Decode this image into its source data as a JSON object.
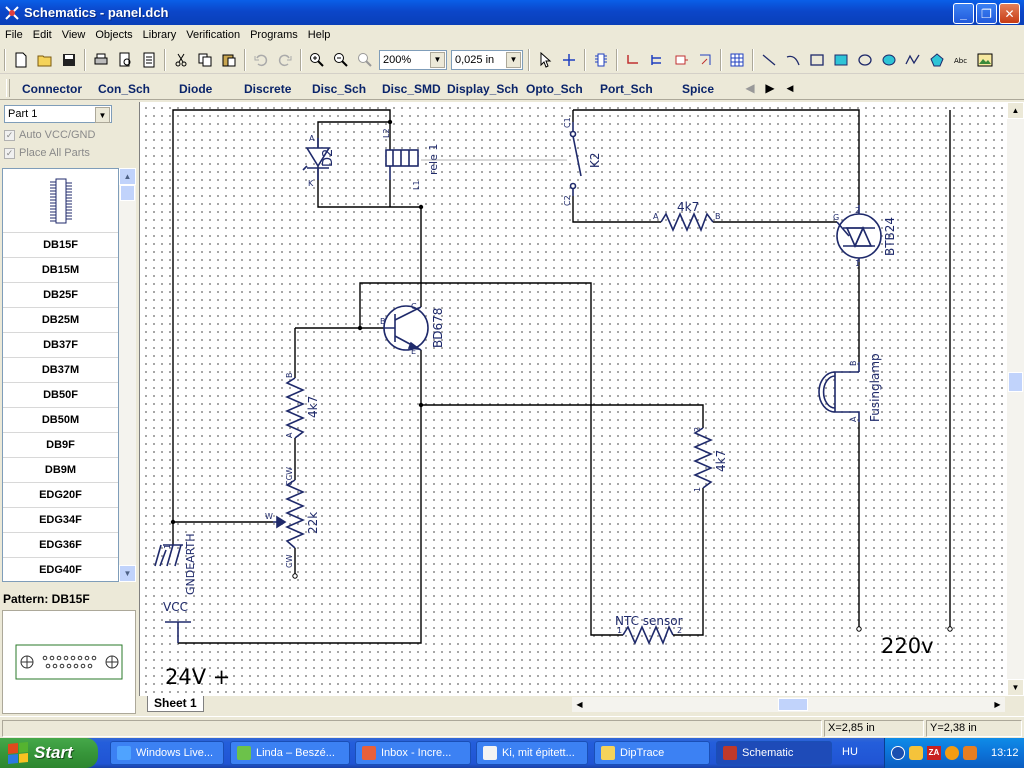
{
  "window": {
    "title": "Schematics - panel.dch",
    "buttons": {
      "minimize": "_",
      "maximize": "❐",
      "close": "✕"
    }
  },
  "menu": [
    "File",
    "Edit",
    "View",
    "Objects",
    "Library",
    "Verification",
    "Programs",
    "Help"
  ],
  "toolbar": {
    "zoom": "200%",
    "grid": "0,025 in"
  },
  "libraries": [
    "Connector",
    "Con_Sch",
    "Diode",
    "Discrete",
    "Disc_Sch",
    "Disc_SMD",
    "Display_Sch",
    "Opto_Sch",
    "Port_Sch",
    "Spice"
  ],
  "left_panel": {
    "part": "Part 1",
    "auto_vcc_gnd": "Auto VCC/GND",
    "place_all_parts": "Place All Parts",
    "patterns": [
      "DB15F",
      "DB15M",
      "DB25F",
      "DB25M",
      "DB37F",
      "DB37M",
      "DB50F",
      "DB50M",
      "DB9F",
      "DB9M",
      "EDG20F",
      "EDG34F",
      "EDG36F",
      "EDG40F"
    ],
    "pattern_label": "Pattern: DB15F"
  },
  "schematic": {
    "labels": {
      "d2": "D2",
      "d2_a": "A",
      "d2_k": "K",
      "rele": "rele 1",
      "l2": "L2",
      "l1": "L1",
      "k2": "K2",
      "c1": "C1",
      "c2": "C2",
      "r_top": "4k7",
      "r_top_a": "A",
      "r_top_b": "B",
      "triac": "BTB24",
      "triac_g": "G",
      "triac_2": "2",
      "triac_1": "1",
      "transistor": "BD678",
      "tr_b": "B",
      "tr_c": "C",
      "tr_e": "E",
      "r_left": "4k7",
      "r_left_a": "A",
      "r_left_b": "B",
      "ccw": "CCW",
      "cw": "CW",
      "w": "W",
      "pot": "22k",
      "gnd": "GNDEARTH",
      "gnd_pin": "1",
      "vcc": "VCC",
      "r_right": "4k7",
      "r_right_1": "1",
      "r_right_2": "2",
      "ntc": "NTC sensor",
      "ntc_1": "1",
      "ntc_2": "2",
      "lamp": "Fusinglamp",
      "lamp_a": "A",
      "lamp_b": "B",
      "v24": "24V +",
      "v220": "220v"
    }
  },
  "sheet": "Sheet 1",
  "status": {
    "x": "X=2,85 in",
    "y": "Y=2,38 in"
  },
  "taskbar": {
    "start": "Start",
    "tasks": [
      "Windows Live...",
      "Linda – Beszé...",
      "Inbox - Incre...",
      "Ki, mit épitett...",
      "DipTrace",
      "Schematic"
    ],
    "lang": "HU",
    "clock": "13:12"
  },
  "colors": {
    "wire": "#000000",
    "component": "#1F2A6B",
    "label_blue": "#1F2A6B",
    "titlebar": "#0A4FD6",
    "library_tab": "#0A246A"
  }
}
